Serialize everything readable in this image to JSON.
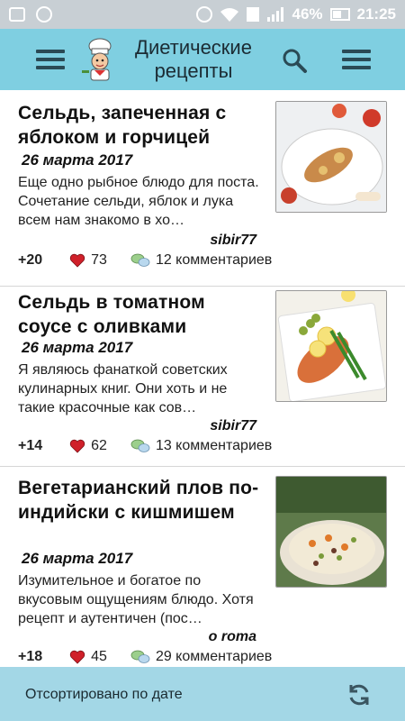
{
  "status_bar": {
    "battery": "46%",
    "time": "21:25"
  },
  "app_bar": {
    "title": "Диетические рецепты",
    "icons": [
      "menu-icon",
      "chef-logo",
      "search-icon",
      "menu-icon"
    ]
  },
  "recipes": [
    {
      "title": "Сельдь, запеченная с яблоком и горчицей",
      "date": "26 марта 2017",
      "description": "Еще одно рыбное блюдо для поста. Сочетание сельди, яблок и лука всем нам знакомо в хо…",
      "author": "sibir77",
      "score": "+20",
      "likes": "73",
      "comments": "12 комментариев"
    },
    {
      "title": "Сельдь в томатном соусе с оливками",
      "date": "26 марта 2017",
      "description": "Я являюсь фанаткой советских кулинарных книг. Они хоть и не такие красочные как сов…",
      "author": "sibir77",
      "score": "+14",
      "likes": "62",
      "comments": "13 комментариев"
    },
    {
      "title": "Вегетарианский плов по-индийски с кишмишем",
      "date": "26 марта 2017",
      "description": "Изумительное и богатое по вкусовым ощущениям блюдо. Хотя рецепт и аутентичен (пос…",
      "author": "o roma",
      "score": "+18",
      "likes": "45",
      "comments": "29 комментариев"
    }
  ],
  "bottom_bar": {
    "sort_label": "Отсортировано по дате"
  },
  "colors": {
    "app_bar": "#7fcfe1",
    "bottom_bar": "#a3d7e6",
    "status_bar": "#c8cfd4",
    "heart": "#d0202a"
  }
}
